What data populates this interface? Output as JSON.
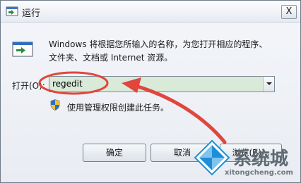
{
  "window": {
    "title": "运行",
    "close_glyph": "X",
    "description_line1": "Windows 将根据您所输入的名称，为您打开相应的程序、",
    "description_line2": "文件夹、文档或 Internet 资源。",
    "open_label": "打开(O):",
    "open_value": "regedit",
    "admin_note": "使用管理权限创建此任务。",
    "ok_label": "确定",
    "cancel_label": "取消",
    "browse_label": "浏览(B)..."
  },
  "watermark": {
    "name": "系统城",
    "url": "xitongcheng.com"
  },
  "colors": {
    "input_bg": "#d9ead9",
    "annotation_red": "#e0463c",
    "watermark_blue": "#1e8fd6"
  },
  "icons": {
    "title": "run-icon",
    "main": "run-icon",
    "shield": "uac-shield-icon",
    "dropdown": "chevron-down-icon"
  }
}
